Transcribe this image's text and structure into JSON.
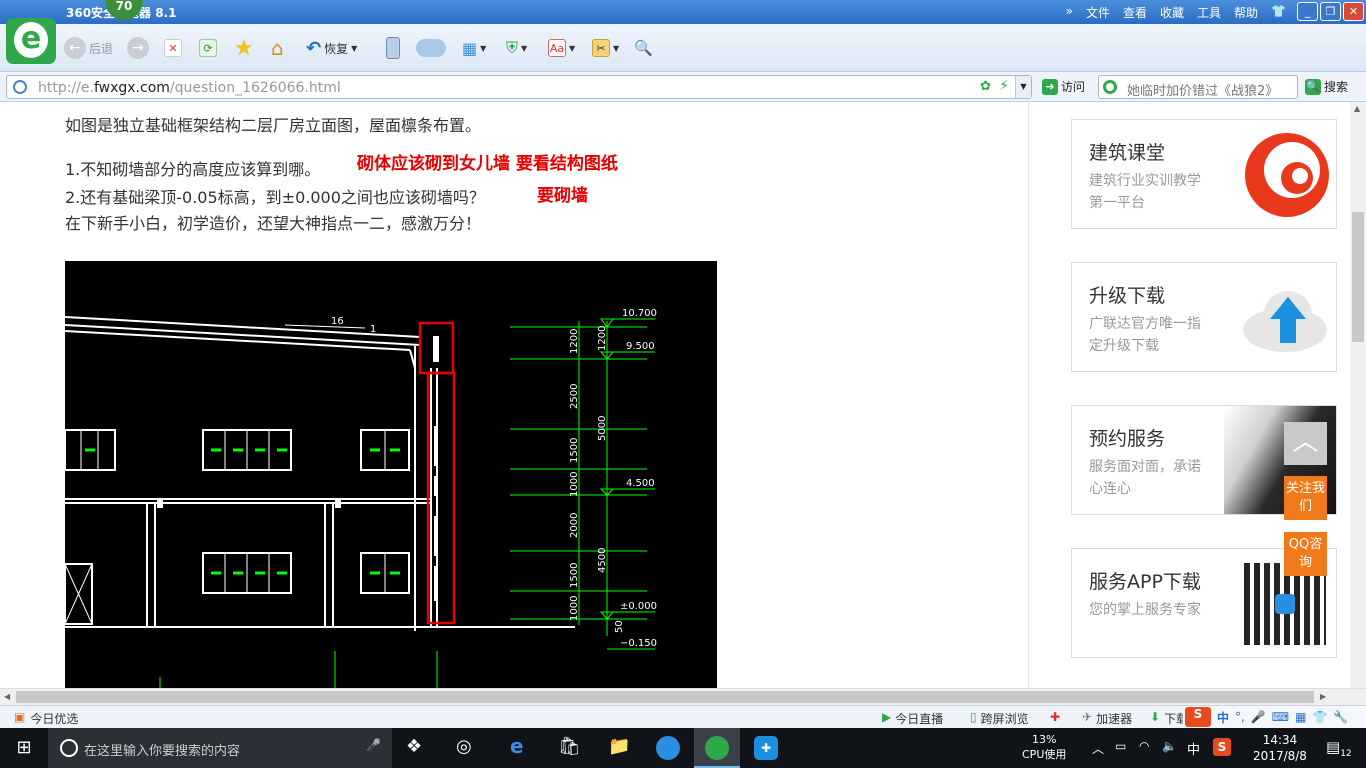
{
  "window": {
    "title": "360安全浏览器 8.1",
    "badge": "70",
    "menu": [
      "文件",
      "查看",
      "收藏",
      "工具",
      "帮助"
    ]
  },
  "toolbar": {
    "back": "后退",
    "restore": "恢复"
  },
  "address": {
    "prefix": "http://e.",
    "domain": "fwxgx.com",
    "path": "/question_1626066.html",
    "visit": "访问",
    "search_text": "她临时加价错过《战狼2》",
    "search_btn": "搜索"
  },
  "question": {
    "line1": "如图是独立基础框架结构二层厂房立面图，屋面檩条布置。",
    "q1": "1.不知砌墙部分的高度应该算到哪。",
    "a1": "砌体应该砌到女儿墙 要看结构图纸",
    "q2": "2.还有基础梁顶-0.05标高，到±0.000之间也应该砌墙吗？",
    "a2": "要砌墙",
    "line4": "在下新手小白，初学造价，还望大神指点一二，感激万分！"
  },
  "drawing": {
    "elevations": [
      "10.700",
      "9.500",
      "4.500",
      "±0.000",
      "−0.150"
    ],
    "dims": [
      "1200",
      "2500",
      "1500",
      "1000",
      "2000",
      "1500",
      "1000"
    ],
    "dims2": [
      "1200",
      "5000",
      "4500",
      "50"
    ],
    "slope_a": "16",
    "slope_b": "1"
  },
  "sidebar": {
    "cards": [
      {
        "title": "建筑课堂",
        "desc": "建筑行业实训教学第一平台"
      },
      {
        "title": "升级下载",
        "desc": "广联达官方唯一指定升级下载"
      },
      {
        "title": "预约服务",
        "desc": "服务面对面，承诺心连心"
      },
      {
        "title": "服务APP下载",
        "desc": "您的掌上服务专家"
      }
    ],
    "follow": "关注我们",
    "qq": "QQ咨询"
  },
  "status": {
    "left": "今日优选",
    "live": "今日直播",
    "cross": "跨屏浏览",
    "accel": "加速器",
    "down": "下载"
  },
  "taskbar": {
    "search": "在这里输入你要搜索的内容",
    "cpu": "13%",
    "cpu_label": "CPU使用",
    "ime": "中",
    "time": "14:34",
    "date": "2017/8/8",
    "notif": "12"
  },
  "colors": {
    "titlebar": "#2c6dc4",
    "cad_green": "#00ff00",
    "annotation_red": "#e60000",
    "float_orange": "#f07a1a"
  }
}
